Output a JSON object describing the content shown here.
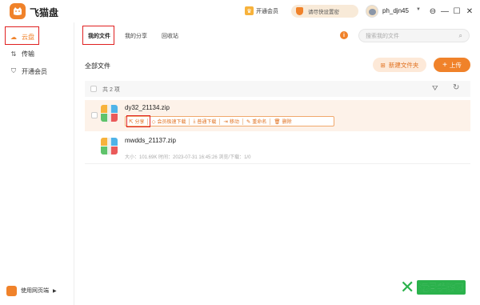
{
  "app": {
    "name": "飞猫盘",
    "open_vip": "开通会员",
    "security_tip": "请尽快设置密",
    "username": "ph_djn45",
    "window_controls": [
      "⊖",
      "—",
      "☐",
      "✕"
    ]
  },
  "sidebar": {
    "items": [
      {
        "label": "云盘",
        "icon": "cloud-icon",
        "active": true
      },
      {
        "label": "传输",
        "icon": "transfer-icon",
        "active": false
      },
      {
        "label": "开通会员",
        "icon": "vip-shield-icon",
        "active": false
      }
    ],
    "web_entry": "使用网页端"
  },
  "tabs": [
    "我的文件",
    "我的分享",
    "回收站"
  ],
  "search": {
    "placeholder": "搜索我的文件"
  },
  "main": {
    "title": "全部文件",
    "new_folder": "新建文件夹",
    "upload": "上传",
    "count": "共 2 项"
  },
  "files": [
    {
      "name": "dy32_21134.zip",
      "meta": "",
      "selected": true
    },
    {
      "name": "mwdds_21137.zip",
      "meta": "大小：101.69K    时间：2023-07-31 16:45:26    浏览/下载：1/0",
      "selected": false
    }
  ],
  "actions": [
    "分享",
    "会员极速下载",
    "普通下载",
    "移动",
    "重命名",
    "删除"
  ],
  "watermark": "远景手游网",
  "colors": {
    "accent": "#f0822a",
    "highlight": "#e02020"
  }
}
